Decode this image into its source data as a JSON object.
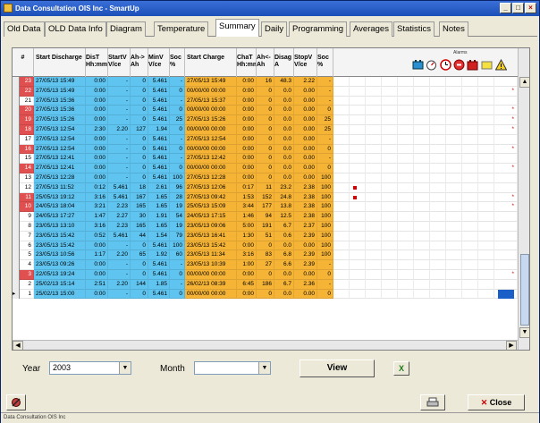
{
  "window": {
    "title": "Data Consultation OIS Inc - SmartUp"
  },
  "tabs": [
    {
      "label": "Old Data",
      "active": false
    },
    {
      "label": "OLD Data Info",
      "active": false
    },
    {
      "label": "Diagram",
      "active": false
    },
    {
      "label": "Temperature",
      "active": false
    },
    {
      "label": "Summary",
      "active": true
    },
    {
      "label": "Daily",
      "active": false
    },
    {
      "label": "Programming",
      "active": false
    },
    {
      "label": "Averages",
      "active": false
    },
    {
      "label": "Statistics",
      "active": false
    },
    {
      "label": "Notes",
      "active": false
    }
  ],
  "table": {
    "headers": {
      "num": "#",
      "start_discharge": "Start Discharge",
      "dischT": "DisT Hh:mm",
      "startV": "StartV V/ce",
      "ah": "Ah-> Ah",
      "minV": "MinV V/ce",
      "soc": "Soc %",
      "start_charge": "Start Charge",
      "chaT": "ChaT Hh:mm",
      "ah2": "Ah<- Ah",
      "diagi": "Disag A",
      "stopV": "StopV V/ce",
      "soc2": "Soc %"
    },
    "alarm_label": "Alarms",
    "alarm_icons": [
      "battery-icon",
      "thermometer-gauge-icon",
      "clock-alarm-icon",
      "stop-alarm-icon",
      "red-battery-icon",
      "yellow-rect-icon",
      "warning-triangle-icon"
    ],
    "rows": [
      {
        "n": "23",
        "sd": "27/05/13 15:49",
        "dt": "0:00",
        "sv": "-",
        "ah": "0",
        "mv": "5.461",
        "soc": "-",
        "sc": "27/05/13 15:49",
        "ct": "0:00",
        "ah2": "16",
        "dg": "48.3",
        "st": "2.22",
        "soc2": "-",
        "hl": true,
        "mark": ""
      },
      {
        "n": "22",
        "sd": "27/05/13 15:49",
        "dt": "0:00",
        "sv": "-",
        "ah": "0",
        "mv": "5.461",
        "soc": "0",
        "sc": "00/00/00 00:00",
        "ct": "0:00",
        "ah2": "0",
        "dg": "0.0",
        "st": "0.00",
        "soc2": "-",
        "hl": true,
        "mark": "*"
      },
      {
        "n": "21",
        "sd": "27/05/13 15:36",
        "dt": "0:00",
        "sv": "-",
        "ah": "0",
        "mv": "5.461",
        "soc": "-",
        "sc": "27/05/13 15:37",
        "ct": "0:00",
        "ah2": "0",
        "dg": "0.0",
        "st": "0.00",
        "soc2": "-",
        "hl": false,
        "mark": ""
      },
      {
        "n": "20",
        "sd": "27/05/13 15:36",
        "dt": "0:00",
        "sv": "-",
        "ah": "0",
        "mv": "5.461",
        "soc": "0",
        "sc": "00/00/00 00:00",
        "ct": "0:00",
        "ah2": "0",
        "dg": "0.0",
        "st": "0.00",
        "soc2": "0",
        "hl": true,
        "mark": "*"
      },
      {
        "n": "19",
        "sd": "27/05/13 15:26",
        "dt": "0:00",
        "sv": "-",
        "ah": "0",
        "mv": "5.461",
        "soc": "25",
        "sc": "27/05/13 15:26",
        "ct": "0:00",
        "ah2": "0",
        "dg": "0.0",
        "st": "0.00",
        "soc2": "25",
        "hl": true,
        "mark": "*"
      },
      {
        "n": "18",
        "sd": "27/05/13 12:54",
        "dt": "2:30",
        "sv": "2.20",
        "ah": "127",
        "mv": "1.94",
        "soc": "0",
        "sc": "00/00/00 00:00",
        "ct": "0:00",
        "ah2": "0",
        "dg": "0.0",
        "st": "0.00",
        "soc2": "25",
        "hl": true,
        "mark": "*"
      },
      {
        "n": "17",
        "sd": "27/05/13 12:54",
        "dt": "0:00",
        "sv": "-",
        "ah": "0",
        "mv": "5.461",
        "soc": "-",
        "sc": "27/05/13 12:54",
        "ct": "0:00",
        "ah2": "0",
        "dg": "0.0",
        "st": "0.00",
        "soc2": "-",
        "hl": false,
        "mark": ""
      },
      {
        "n": "16",
        "sd": "27/05/13 12:54",
        "dt": "0:00",
        "sv": "-",
        "ah": "0",
        "mv": "5.461",
        "soc": "0",
        "sc": "00/00/00 00:00",
        "ct": "0:00",
        "ah2": "0",
        "dg": "0.0",
        "st": "0.00",
        "soc2": "0",
        "hl": true,
        "mark": "*"
      },
      {
        "n": "15",
        "sd": "27/05/13 12:41",
        "dt": "0:00",
        "sv": "-",
        "ah": "0",
        "mv": "5.461",
        "soc": "-",
        "sc": "27/05/13 12:42",
        "ct": "0:00",
        "ah2": "0",
        "dg": "0.0",
        "st": "0.00",
        "soc2": "-",
        "hl": false,
        "mark": ""
      },
      {
        "n": "14",
        "sd": "27/05/13 12:41",
        "dt": "0:00",
        "sv": "-",
        "ah": "0",
        "mv": "5.461",
        "soc": "0",
        "sc": "00/00/00 00:00",
        "ct": "0:00",
        "ah2": "0",
        "dg": "0.0",
        "st": "0.00",
        "soc2": "0",
        "hl": true,
        "mark": "*"
      },
      {
        "n": "13",
        "sd": "27/05/13 12:28",
        "dt": "0:00",
        "sv": "-",
        "ah": "0",
        "mv": "5.461",
        "soc": "100",
        "sc": "27/05/13 12:28",
        "ct": "0:00",
        "ah2": "0",
        "dg": "0.0",
        "st": "0.00",
        "soc2": "100",
        "hl": false,
        "mark": ""
      },
      {
        "n": "12",
        "sd": "27/05/13 11:52",
        "dt": "0:12",
        "sv": "5.461",
        "ah": "18",
        "mv": "2.61",
        "soc": "96",
        "sc": "27/05/13 12:06",
        "ct": "0:17",
        "ah2": "11",
        "dg": "23.2",
        "st": "2.38",
        "soc2": "100",
        "hl": false,
        "mark": ""
      },
      {
        "n": "11",
        "sd": "25/05/13 19:12",
        "dt": "3:16",
        "sv": "5.461",
        "ah": "167",
        "mv": "1.65",
        "soc": "28",
        "sc": "27/05/13 09:42",
        "ct": "1:53",
        "ah2": "152",
        "dg": "24.8",
        "st": "2.38",
        "soc2": "100",
        "hl": true,
        "mark": "*"
      },
      {
        "n": "10",
        "sd": "24/05/13 18:04",
        "dt": "3:21",
        "sv": "2.23",
        "ah": "165",
        "mv": "1.65",
        "soc": "19",
        "sc": "25/05/13 15:09",
        "ct": "3:44",
        "ah2": "177",
        "dg": "13.8",
        "st": "2.38",
        "soc2": "100",
        "hl": true,
        "mark": "*"
      },
      {
        "n": "9",
        "sd": "24/05/13 17:27",
        "dt": "1:47",
        "sv": "2.27",
        "ah": "30",
        "mv": "1.91",
        "soc": "54",
        "sc": "24/05/13 17:15",
        "ct": "1:46",
        "ah2": "94",
        "dg": "12.5",
        "st": "2.38",
        "soc2": "100",
        "hl": false,
        "mark": ""
      },
      {
        "n": "8",
        "sd": "23/05/13 13:10",
        "dt": "3:16",
        "sv": "2.23",
        "ah": "165",
        "mv": "1.65",
        "soc": "19",
        "sc": "23/05/13 09:06",
        "ct": "5:00",
        "ah2": "191",
        "dg": "6.7",
        "st": "2.37",
        "soc2": "100",
        "hl": false,
        "mark": ""
      },
      {
        "n": "7",
        "sd": "23/05/13 15:42",
        "dt": "0:52",
        "sv": "5.461",
        "ah": "44",
        "mv": "1.54",
        "soc": "79",
        "sc": "23/05/13 16:41",
        "ct": "1:30",
        "ah2": "51",
        "dg": "0.6",
        "st": "2.39",
        "soc2": "100",
        "hl": false,
        "mark": ""
      },
      {
        "n": "6",
        "sd": "23/05/13 15:42",
        "dt": "0:00",
        "sv": "-",
        "ah": "0",
        "mv": "5.461",
        "soc": "100",
        "sc": "23/05/13 15:42",
        "ct": "0:00",
        "ah2": "0",
        "dg": "0.0",
        "st": "0.00",
        "soc2": "100",
        "hl": false,
        "mark": ""
      },
      {
        "n": "5",
        "sd": "23/05/13 10:56",
        "dt": "1:17",
        "sv": "2.20",
        "ah": "65",
        "mv": "1.92",
        "soc": "60",
        "sc": "23/05/13 11:34",
        "ct": "3:16",
        "ah2": "83",
        "dg": "6.8",
        "st": "2.39",
        "soc2": "100",
        "hl": false,
        "mark": ""
      },
      {
        "n": "4",
        "sd": "23/05/13 09:26",
        "dt": "0:00",
        "sv": "-",
        "ah": "0",
        "mv": "5.461",
        "soc": "-",
        "sc": "23/05/13 10:39",
        "ct": "1:00",
        "ah2": "27",
        "dg": "6.6",
        "st": "2.39",
        "soc2": "-",
        "hl": false,
        "mark": ""
      },
      {
        "n": "3",
        "sd": "22/05/13 19:24",
        "dt": "0:00",
        "sv": "-",
        "ah": "0",
        "mv": "5.461",
        "soc": "0",
        "sc": "00/00/00 00:00",
        "ct": "0:00",
        "ah2": "0",
        "dg": "0.0",
        "st": "0.00",
        "soc2": "0",
        "hl": true,
        "mark": "*"
      },
      {
        "n": "2",
        "sd": "25/02/13 15:14",
        "dt": "2:51",
        "sv": "2.20",
        "ah": "144",
        "mv": "1.85",
        "soc": "-",
        "sc": "26/02/13 08:39",
        "ct": "6:45",
        "ah2": "186",
        "dg": "6.7",
        "st": "2.36",
        "soc2": "-",
        "hl": false,
        "mark": ""
      },
      {
        "n": "1",
        "sd": "25/02/13 15:00",
        "dt": "0:00",
        "sv": "-",
        "ah": "0",
        "mv": "5.461",
        "soc": "0",
        "sc": "00/00/00 00:00",
        "ct": "0:00",
        "ah2": "0",
        "dg": "0.0",
        "st": "0.00",
        "soc2": "0",
        "hl": false,
        "mark": ""
      }
    ]
  },
  "filters": {
    "year_label": "Year",
    "year_value": "2003",
    "month_label": "Month",
    "month_value": "",
    "view_label": "View",
    "excel_label": "X"
  },
  "footer": {
    "close_label": "Close",
    "status_text": "Data Consultation OIS Inc"
  },
  "colors": {
    "discharge": "#5fc4f0",
    "charge": "#f6b436",
    "highlight": "#e05050"
  }
}
